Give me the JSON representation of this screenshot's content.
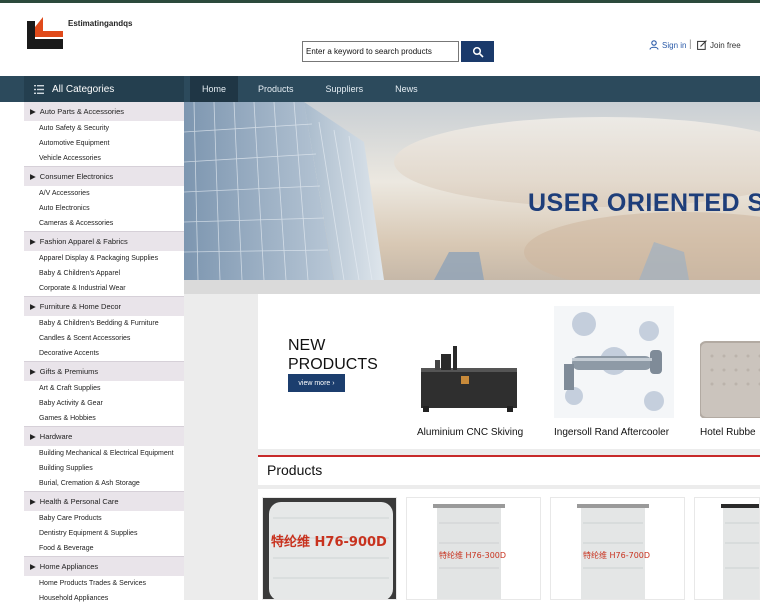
{
  "brand": {
    "name": "Estimatingandqs"
  },
  "search": {
    "placeholder": "Enter a keyword to search products"
  },
  "account": {
    "signin": "Sign in",
    "divider": "|",
    "join": "Join free"
  },
  "nav": {
    "all_categories": "All Categories",
    "links": [
      "Home",
      "Products",
      "Suppliers",
      "News"
    ],
    "active": "Home"
  },
  "categories": [
    {
      "name": "Auto Parts & Accessories",
      "items": [
        "Auto Safety & Security",
        "Automotive Equipment",
        "Vehicle Accessories"
      ]
    },
    {
      "name": "Consumer Electronics",
      "items": [
        "A/V Accessories",
        "Auto Electronics",
        "Cameras & Accessories"
      ]
    },
    {
      "name": "Fashion Apparel & Fabrics",
      "items": [
        "Apparel Display & Packaging Supplies",
        "Baby & Children's Apparel",
        "Corporate & Industrial Wear"
      ]
    },
    {
      "name": "Furniture & Home Decor",
      "items": [
        "Baby & Children's Bedding & Furniture",
        "Candles & Scent Accessories",
        "Decorative Accents"
      ]
    },
    {
      "name": "Gifts & Premiums",
      "items": [
        "Art & Craft Supplies",
        "Baby Activity & Gear",
        "Games & Hobbies"
      ]
    },
    {
      "name": "Hardware",
      "items": [
        "Building Mechanical & Electrical Equipment",
        "Building Supplies",
        "Burial, Cremation & Ash Storage"
      ]
    },
    {
      "name": "Health & Personal Care",
      "items": [
        "Baby Care Products",
        "Dentistry Equipment & Supplies",
        "Food & Beverage"
      ]
    },
    {
      "name": "Home Appliances",
      "items": [
        "Home Products Trades & Services",
        "Household Appliances"
      ]
    }
  ],
  "banner": {
    "headline": "USER ORIENTED S"
  },
  "new_products": {
    "title_line1": "NEW",
    "title_line2": "PRODUCTS",
    "view_more": "view more",
    "items": [
      {
        "name": "Aluminium CNC Skiving"
      },
      {
        "name": "Ingersoll Rand Aftercooler"
      },
      {
        "name": "Hotel Rubbe"
      }
    ]
  },
  "products": {
    "title": "Products",
    "cards": [
      {
        "label": "特纶维 H76-900D"
      },
      {
        "label": "特纶维 H76-300D"
      },
      {
        "label": "特纶维 H76-700D"
      },
      {
        "label": ""
      }
    ]
  },
  "colors": {
    "nav_bg": "#2c4a5c",
    "accent_blue": "#1c3e6e",
    "category_bg": "#e9e4ea",
    "products_rule": "#c72a2a",
    "banner_text": "#1e3e7a"
  }
}
